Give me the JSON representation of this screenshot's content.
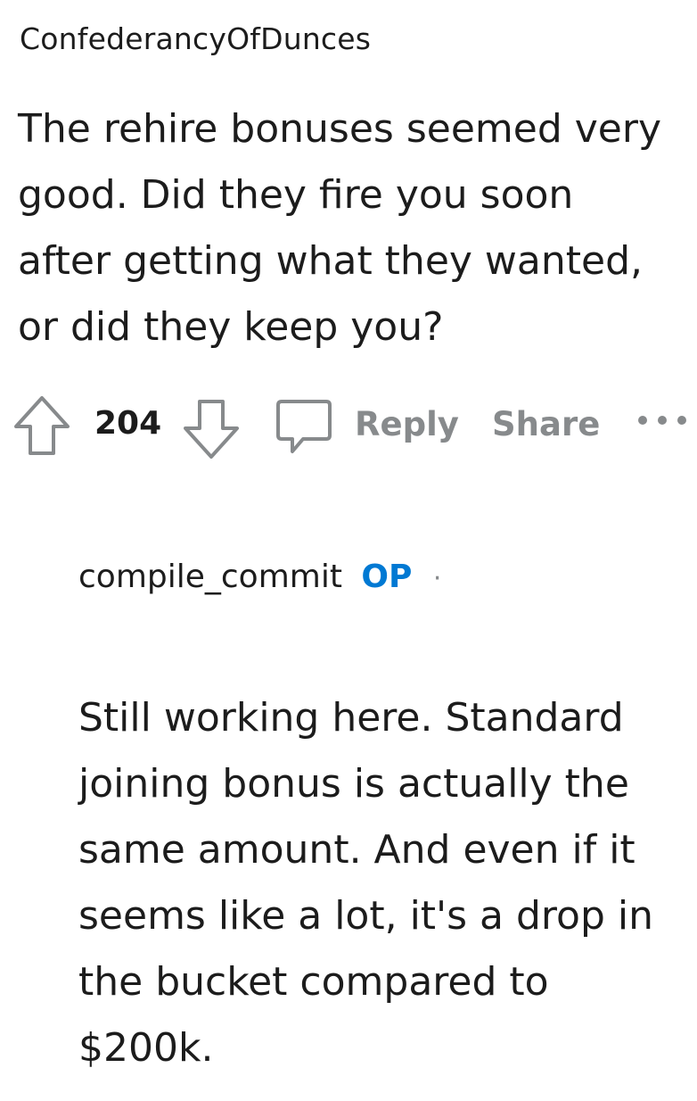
{
  "comment": {
    "author": "ConfederancyOfDunces",
    "body": "The rehire bonuses seemed very good. Did they fire you soon after getting what they wanted, or did they keep you?",
    "vote_count": "204",
    "reply_label": "Reply",
    "share_label": "Share",
    "icons": [
      "upvote-icon",
      "downvote-icon",
      "comment-bubble-icon",
      "more-options-icon"
    ]
  },
  "reply": {
    "author": "compile_commit",
    "badge": "OP",
    "separator": "·",
    "body": "Still working here. Standard joining bonus is actually the same amount. And even if it seems like a lot, it's a drop in the bucket compared to $200k."
  },
  "colors": {
    "text": "#1c1c1c",
    "muted": "#878a8c",
    "op_badge": "#0079d3",
    "background": "#ffffff"
  }
}
